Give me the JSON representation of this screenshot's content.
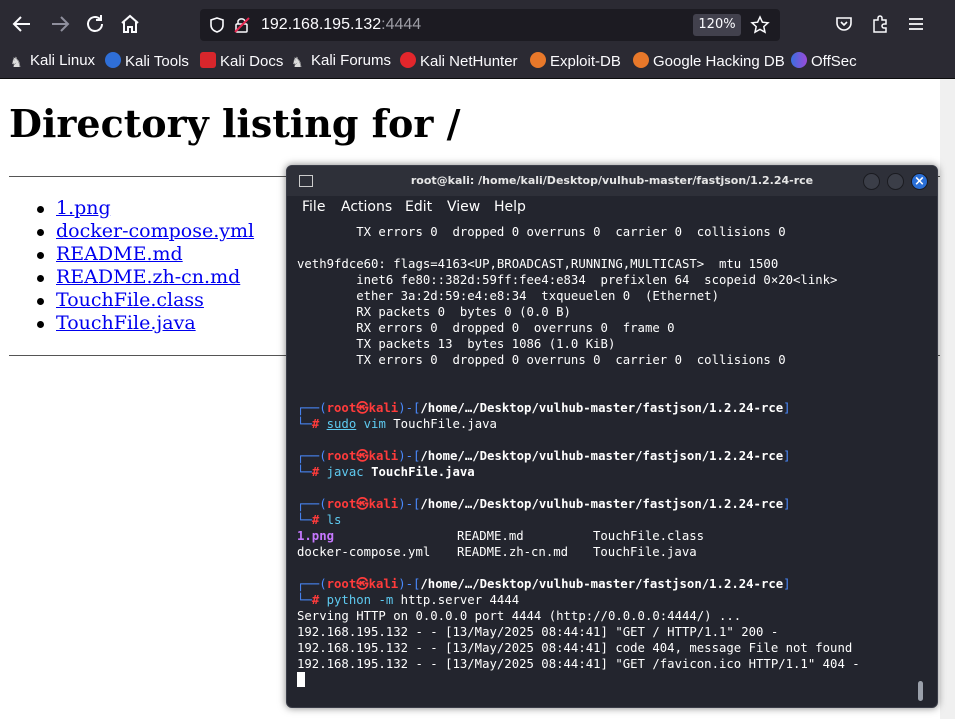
{
  "browser": {
    "url_host": "192.168.195.132",
    "url_port": ":4444",
    "zoom": "120%",
    "bookmarks": [
      "Kali Linux",
      "Kali Tools",
      "Kali Docs",
      "Kali Forums",
      "Kali NetHunter",
      "Exploit-DB",
      "Google Hacking DB",
      "OffSec"
    ]
  },
  "page": {
    "heading": "Directory listing for /",
    "files": [
      "1.png",
      "docker-compose.yml",
      "README.md",
      "README.zh-cn.md",
      "TouchFile.class",
      "TouchFile.java"
    ]
  },
  "terminal": {
    "title": "root@kali: /home/kali/Desktop/vulhub-master/fastjson/1.2.24-rce",
    "menu": [
      "File",
      "Actions",
      "Edit",
      "View",
      "Help"
    ],
    "output_top": [
      "        TX errors 0  dropped 0 overruns 0  carrier 0  collisions 0",
      "",
      "veth9fdce60: flags=4163<UP,BROADCAST,RUNNING,MULTICAST>  mtu 1500",
      "        inet6 fe80::382d:59ff:fee4:e834  prefixlen 64  scopeid 0×20<link>",
      "        ether 3a:2d:59:e4:e8:34  txqueuelen 0  (Ethernet)",
      "        RX packets 0  bytes 0 (0.0 B)",
      "        RX errors 0  dropped 0  overruns 0  frame 0",
      "        TX packets 13  bytes 1086 (1.0 KiB)",
      "        TX errors 0  dropped 0 overruns 0  carrier 0  collisions 0"
    ],
    "prompt": {
      "user": "root",
      "at": "㉿",
      "host": "kali",
      "path": "/home/…/Desktop/vulhub-master/fastjson/1.2.24-rce",
      "symbol": "#"
    },
    "cmd1": {
      "sudo": "sudo",
      "vim": "vim",
      "arg": "TouchFile.java"
    },
    "cmd2": {
      "prog": "javac",
      "arg": "TouchFile.java"
    },
    "cmd3": {
      "prog": "ls"
    },
    "ls_row1": {
      "a": "1.png",
      "b": "README.md",
      "c": "TouchFile.class"
    },
    "ls_row2": {
      "a": "docker-compose.yml",
      "b": "README.zh-cn.md",
      "c": "TouchFile.java"
    },
    "cmd4": {
      "prog": "python",
      "flag": "-m",
      "args": "http.server 4444"
    },
    "server_output": [
      "Serving HTTP on 0.0.0.0 port 4444 (http://0.0.0.0:4444/) ...",
      "192.168.195.132 - - [13/May/2025 08:44:41] \"GET / HTTP/1.1\" 200 -",
      "192.168.195.132 - - [13/May/2025 08:44:41] code 404, message File not found",
      "192.168.195.132 - - [13/May/2025 08:44:41] \"GET /favicon.ico HTTP/1.1\" 404 -"
    ]
  }
}
